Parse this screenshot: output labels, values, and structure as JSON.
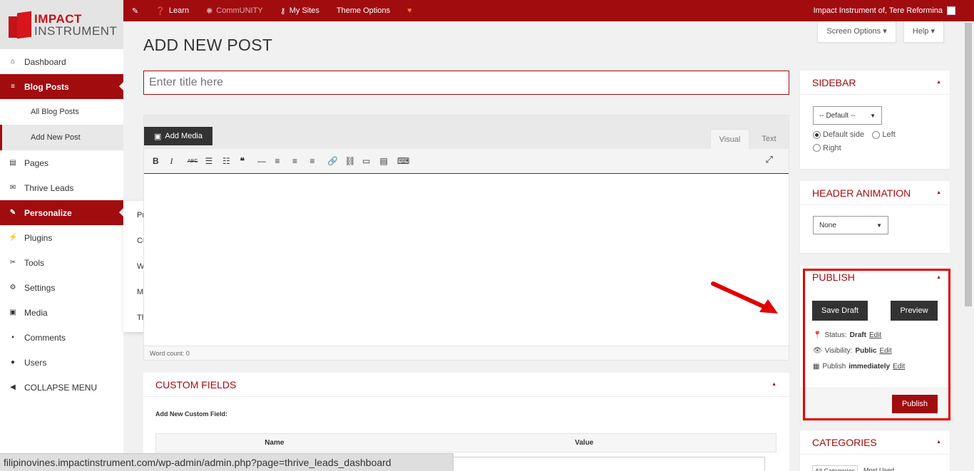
{
  "topbar": {
    "items": [
      {
        "icon": "pencil-icon",
        "label": ""
      },
      {
        "icon": "question-icon",
        "label": "Learn"
      },
      {
        "icon": "community-icon",
        "label": "CommUNITY"
      },
      {
        "icon": "key-icon",
        "label": "My Sites"
      },
      {
        "icon": "",
        "label": "Theme Options"
      },
      {
        "icon": "heart-icon",
        "label": ""
      }
    ],
    "user": "Impact Instrument of, Tere Reformina"
  },
  "logo": {
    "line1": "IMPACT",
    "line2": "INSTRUMENT"
  },
  "sidebar": {
    "items": [
      {
        "label": "Dashboard",
        "icon": "home-icon"
      },
      {
        "label": "Blog Posts",
        "icon": "posts-icon"
      },
      {
        "label": "All Blog Posts"
      },
      {
        "label": "Add New Post"
      },
      {
        "label": "Pages",
        "icon": "pages-icon"
      },
      {
        "label": "Thrive Leads",
        "icon": "mail-icon"
      },
      {
        "label": "Personalize",
        "icon": "brush-icon"
      },
      {
        "label": "Plugins",
        "icon": "plug-icon"
      },
      {
        "label": "Tools",
        "icon": "wrench-icon"
      },
      {
        "label": "Settings",
        "icon": "gear-icon"
      },
      {
        "label": "Media",
        "icon": "media-icon"
      },
      {
        "label": "Comments",
        "icon": "comment-icon"
      },
      {
        "label": "Users",
        "icon": "users-icon"
      },
      {
        "label": "COLLAPSE MENU",
        "icon": "collapse-icon"
      }
    ]
  },
  "flyout": [
    "Premium Themes",
    "Customize",
    "Widgets",
    "Menus",
    "Theme Options"
  ],
  "header": {
    "page_title": "ADD NEW POST",
    "screen_options": "Screen Options",
    "help": "Help"
  },
  "editor": {
    "title_placeholder": "Enter title here",
    "add_media": "Add Media",
    "tab_visual": "Visual",
    "tab_text": "Text",
    "word_count": "Word count: 0"
  },
  "custom_fields": {
    "title": "CUSTOM FIELDS",
    "add_label": "Add New Custom Field:",
    "col_name": "Name",
    "col_value": "Value"
  },
  "sidebar_box": {
    "title": "SIDEBAR",
    "select": "-- Default --",
    "opt_default": "Default side",
    "opt_left": "Left",
    "opt_right": "Right"
  },
  "header_anim": {
    "title": "HEADER ANIMATION",
    "select": "None"
  },
  "publish": {
    "title": "PUBLISH",
    "save_draft": "Save Draft",
    "preview": "Preview",
    "status_label": "Status:",
    "status_value": "Draft",
    "visibility_label": "Visibility:",
    "visibility_value": "Public",
    "publish_label": "Publish",
    "publish_value": "immediately",
    "edit": "Edit",
    "publish_button": "Publish"
  },
  "categories": {
    "title": "CATEGORIES",
    "tab1": "All Categories",
    "tab2": "Most Used"
  },
  "statusbar_url": "filipinovines.impactinstrument.com/wp-admin/admin.php?page=thrive_leads_dashboard",
  "colors": {
    "brand": "#a10c0f",
    "highlight": "#e00000"
  }
}
